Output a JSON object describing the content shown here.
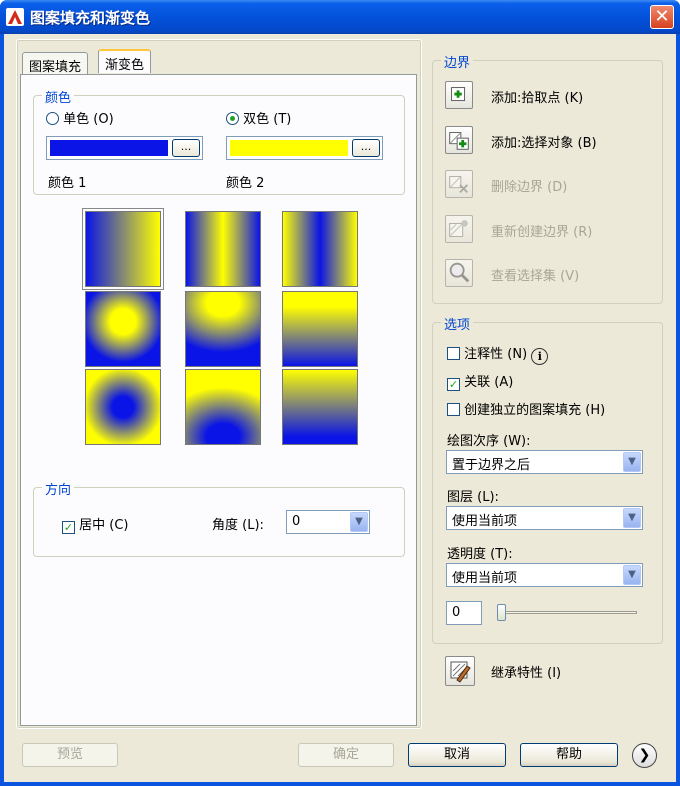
{
  "window": {
    "title": "图案填充和渐变色",
    "close_glyph": "✕"
  },
  "tabs": [
    {
      "label": "图案填充",
      "active": false
    },
    {
      "label": "渐变色",
      "active": true
    }
  ],
  "color_group": {
    "label": "颜色",
    "single": {
      "label": "单色 (O)",
      "checked": false
    },
    "double": {
      "label": "双色 (T)",
      "checked": true
    },
    "color1": {
      "label": "颜色 1",
      "value": "#0a14e6"
    },
    "color2": {
      "label": "颜色 2",
      "value": "#ffff00"
    },
    "browse": "..."
  },
  "gradients": {
    "color_a": "#0a14e6",
    "color_b": "#ffff00",
    "selected_index": 0
  },
  "direction_group": {
    "label": "方向",
    "center_label": "居中 (C)",
    "center_checked": true,
    "angle_label": "角度 (L):",
    "angle_value": "0"
  },
  "boundary_group": {
    "label": "边界",
    "items": [
      {
        "label": "添加:拾取点 (K)",
        "icon": "pick-point-icon",
        "enabled": true
      },
      {
        "label": "添加:选择对象 (B)",
        "icon": "select-objects-icon",
        "enabled": true
      },
      {
        "label": "删除边界 (D)",
        "icon": "remove-boundary-icon",
        "enabled": false
      },
      {
        "label": "重新创建边界 (R)",
        "icon": "recreate-boundary-icon",
        "enabled": false
      },
      {
        "label": "查看选择集 (V)",
        "icon": "view-selection-icon",
        "enabled": false
      }
    ]
  },
  "options_group": {
    "label": "选项",
    "annotative": {
      "label": "注释性 (N)",
      "checked": false,
      "info_icon": "info-icon"
    },
    "associative": {
      "label": "关联 (A)",
      "checked": true
    },
    "separate": {
      "label": "创建独立的图案填充 (H)",
      "checked": false
    },
    "draw_order": {
      "label": "绘图次序 (W):",
      "value": "置于边界之后"
    },
    "layer": {
      "label": "图层 (L):",
      "value": "使用当前项"
    },
    "transparency": {
      "label": "透明度 (T):",
      "value": "使用当前项",
      "amount": "0",
      "slider_fraction": 0
    }
  },
  "inherit": {
    "label": "继承特性 (I)",
    "icon": "inherit-properties-icon"
  },
  "footer": {
    "preview": "预览",
    "ok": "确定",
    "cancel": "取消",
    "help": "帮助",
    "more_glyph": "❯"
  }
}
